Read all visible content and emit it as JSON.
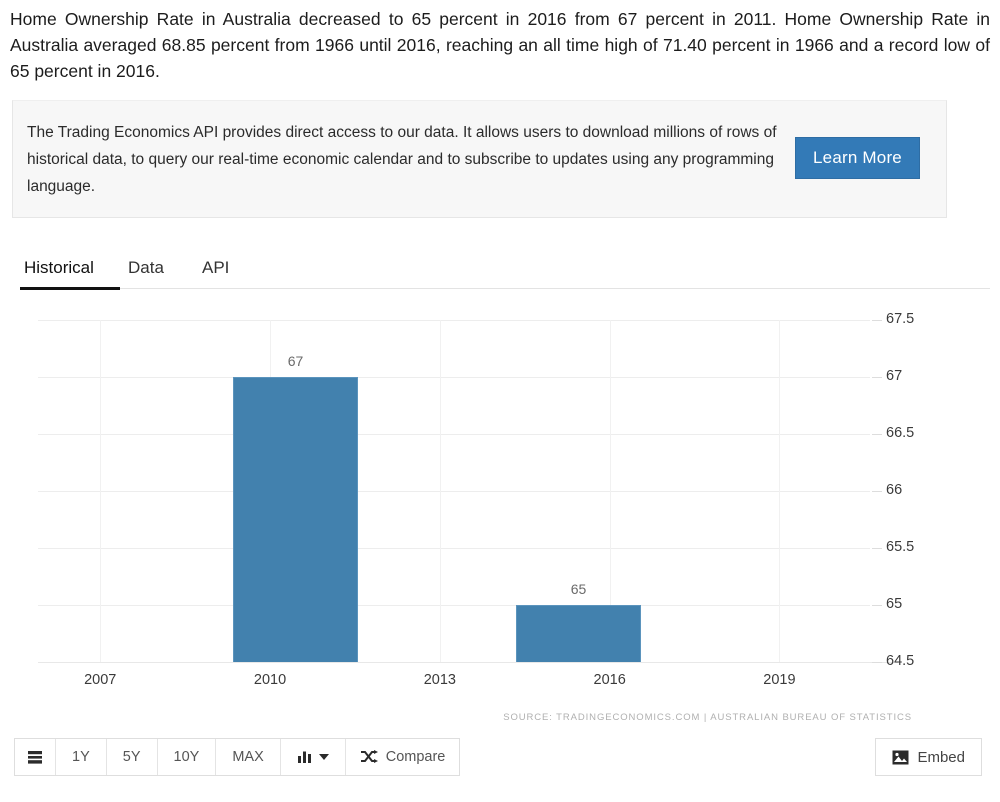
{
  "intro": {
    "text": "Home Ownership Rate in Australia decreased to 65 percent in 2016 from 67 percent in 2011. Home Ownership Rate in Australia averaged 68.85 percent from 1966 until 2016, reaching an all time high of 71.40 percent in 1966 and a record low of 65 percent in 2016."
  },
  "api_banner": {
    "text": "The Trading Economics API provides direct access to our data. It allows users to download millions of rows of historical data, to query our real-time economic calendar and to subscribe to updates using any programming language.",
    "button_label": "Learn More",
    "button_color": "#337ab7"
  },
  "tabs": [
    {
      "label": "Historical",
      "active": true
    },
    {
      "label": "Data",
      "active": false
    },
    {
      "label": "API",
      "active": false
    }
  ],
  "toolbar": {
    "list_icon": "list-icon",
    "ranges": [
      "1Y",
      "5Y",
      "10Y",
      "MAX"
    ],
    "chart_type_icon": "bar-chart-icon",
    "chart_type_caret": "caret-down-icon",
    "compare_icon": "shuffle-icon",
    "compare_label": "Compare",
    "embed_icon": "image-icon",
    "embed_label": "Embed"
  },
  "chart_data": {
    "type": "bar",
    "title": "",
    "xlabel": "",
    "ylabel": "",
    "categories": [
      "2011",
      "2016"
    ],
    "values": [
      67,
      65
    ],
    "data_labels": [
      "67",
      "65"
    ],
    "ylim": [
      64.5,
      67.5
    ],
    "yticks": [
      "67.5",
      "67",
      "66.5",
      "66",
      "65.5",
      "65",
      "64.5"
    ],
    "ytick_values": [
      67.5,
      67,
      66.5,
      66,
      65.5,
      65,
      64.5
    ],
    "xticks": [
      "2007",
      "2010",
      "2013",
      "2016",
      "2019"
    ],
    "xtick_values": [
      2007,
      2010,
      2013,
      2016,
      2019
    ],
    "grid": true,
    "legend": false,
    "bar_color": "#4281ae",
    "source": "SOURCE: TRADINGECONOMICS.COM  |  AUSTRALIAN BUREAU OF STATISTICS"
  }
}
